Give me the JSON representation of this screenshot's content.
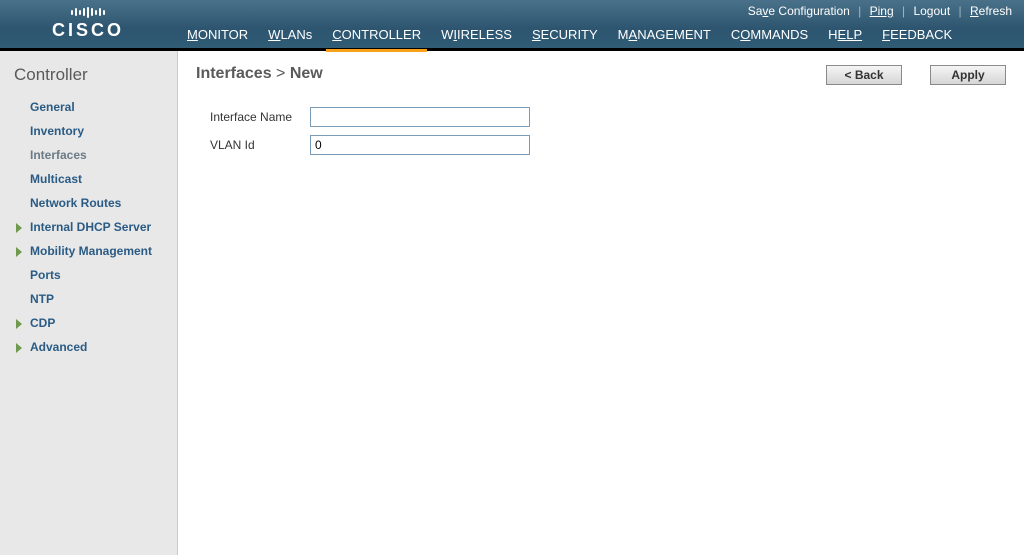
{
  "logo_text": "CISCO",
  "util_links": {
    "save": "Save Configuration",
    "ping": "Ping",
    "logout": "Logout",
    "refresh": "Refresh"
  },
  "nav": {
    "monitor": "ONITOR",
    "wlans": "LANs",
    "controller": "ONTROLLER",
    "wireless": "IRELESS",
    "security": "ECURITY",
    "management": "NAGEMENT",
    "commands": "MMANDS",
    "help": "ELP",
    "feedback": "EEDBACK"
  },
  "sidebar": {
    "title": "Controller",
    "items": [
      {
        "label": "General"
      },
      {
        "label": "Inventory"
      },
      {
        "label": "Interfaces"
      },
      {
        "label": "Multicast"
      },
      {
        "label": "Network Routes"
      },
      {
        "label": "Internal DHCP Server"
      },
      {
        "label": "Mobility Management"
      },
      {
        "label": "Ports"
      },
      {
        "label": "NTP"
      },
      {
        "label": "CDP"
      },
      {
        "label": "Advanced"
      }
    ]
  },
  "breadcrumb": {
    "root": "Interfaces",
    "sep": " > ",
    "leaf": "New"
  },
  "buttons": {
    "back": "< Back",
    "apply": "Apply"
  },
  "form": {
    "iface_label": "Interface Name",
    "iface_value": "",
    "vlan_label": "VLAN Id",
    "vlan_value": "0"
  }
}
